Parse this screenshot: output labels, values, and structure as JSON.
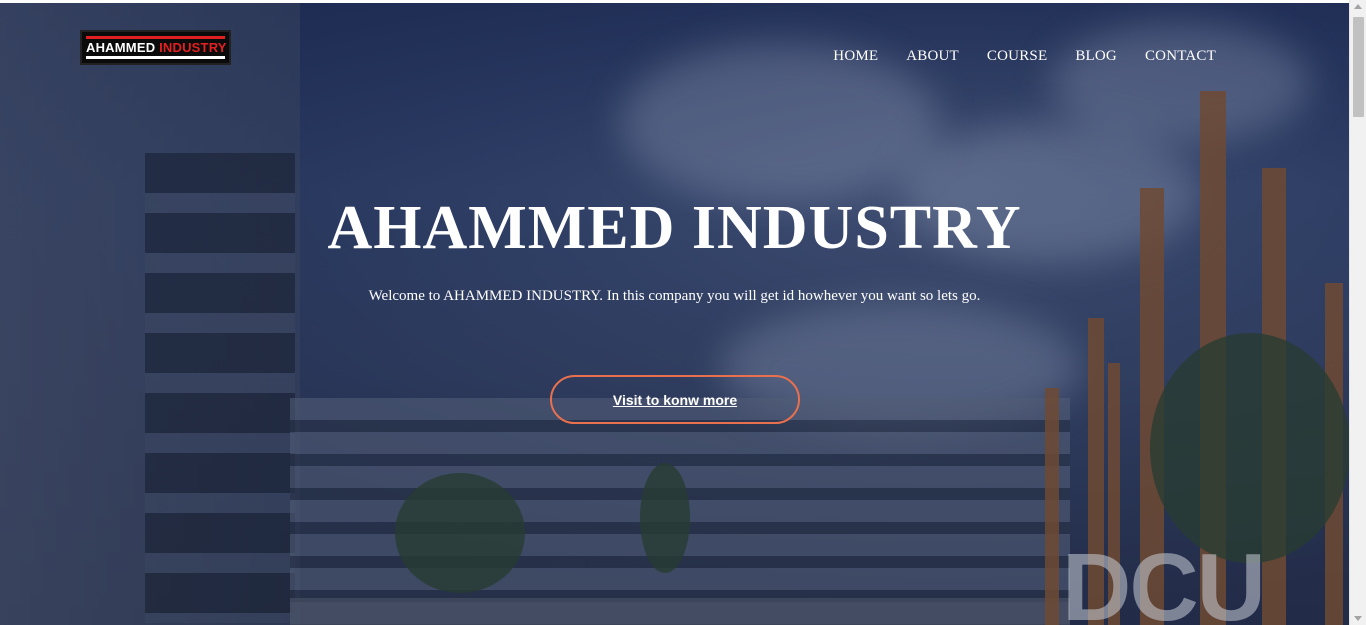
{
  "logo": {
    "text_white": "AHAMMED",
    "text_red": "INDUSTRY"
  },
  "nav": {
    "items": [
      "HOME",
      "ABOUT",
      "COURSE",
      "BLOG",
      "CONTACT"
    ]
  },
  "hero": {
    "title": "AHAMMED INDUSTRY",
    "subtitle": "Welcome to AHAMMED INDUSTRY. In this company you will get id howhever you want so lets go.",
    "cta_label": "Visit to konw more",
    "sign_text": "DCU"
  },
  "colors": {
    "accent": "#e8704f",
    "logo_red": "#e12121",
    "overlay": "#1a2650"
  }
}
